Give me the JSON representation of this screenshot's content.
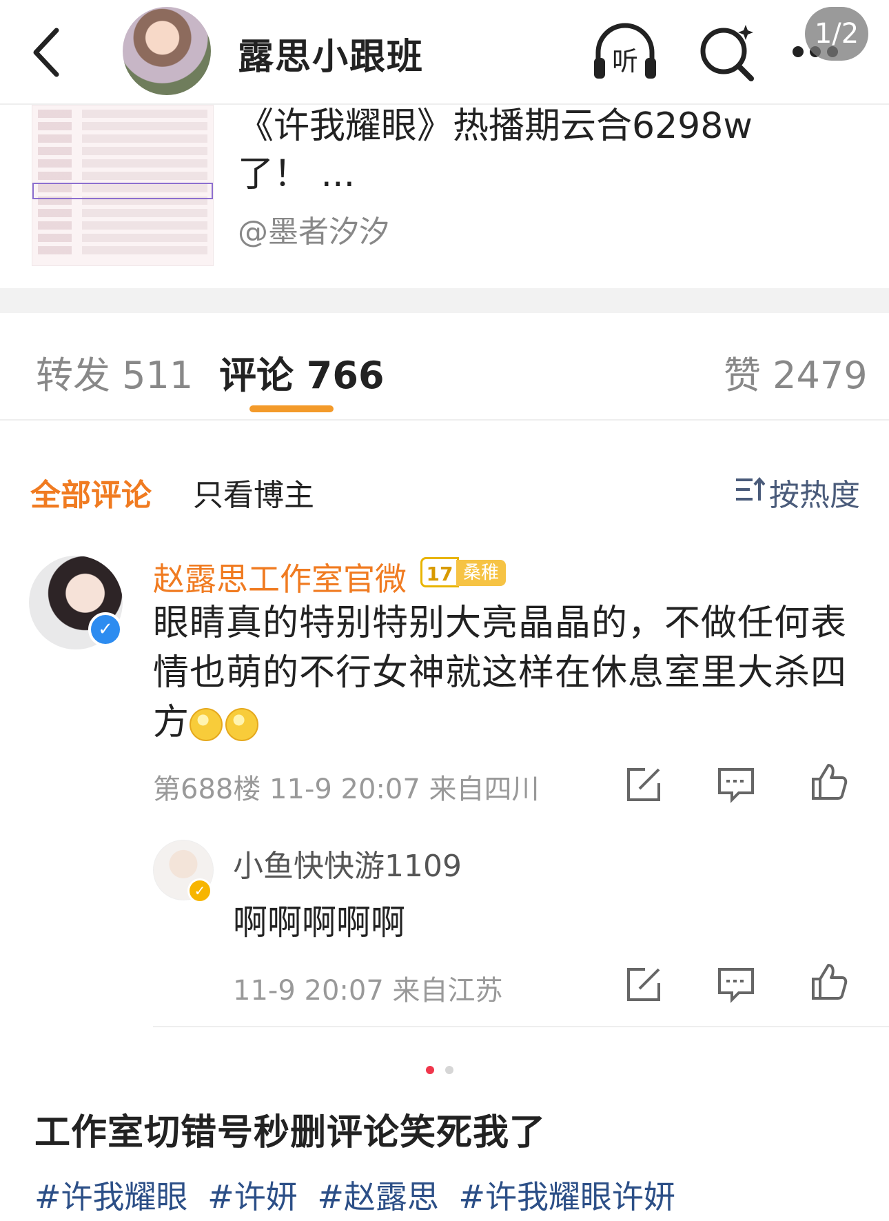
{
  "header": {
    "title": "露思小跟班",
    "page_indicator": "1/2",
    "listen_label": "听"
  },
  "repost_card": {
    "text": "《许我耀眼》热播期云合6298w了！ ...",
    "author": "@墨者汐汐"
  },
  "tabs": {
    "repost": "转发 511",
    "comment": "评论 766",
    "like": "赞 2479"
  },
  "filter": {
    "all": "全部评论",
    "owner_only": "只看博主",
    "sort": "按热度"
  },
  "comment": {
    "username": "赵露思工作室官微",
    "level": "17",
    "level_tag": "桑稚",
    "text": "眼睛真的特别特别大亮晶晶的，不做任何表情也萌的不行女神就这样在休息室里大杀四方",
    "meta": "第688楼 11-9 20:07 来自四川",
    "reply": {
      "username": "小鱼快快游1109",
      "text": "啊啊啊啊啊",
      "meta": "11-9 20:07 来自江苏"
    }
  },
  "post": {
    "caption": "工作室切错号秒删评论笑死我了",
    "tags": [
      "#许我耀眼",
      "#许妍",
      "#赵露思",
      "#许我耀眼许妍"
    ]
  },
  "colors": {
    "accent": "#f07b21",
    "tab_underline": "#f39a2a",
    "tag": "#2c4f87",
    "verified": "#2d8cf0",
    "active_dot": "#f0364b"
  },
  "icons": [
    "back-icon",
    "listen-icon",
    "search-icon",
    "more-icon",
    "sort-icon",
    "share-icon",
    "reply-icon",
    "like-icon",
    "verified-icon"
  ]
}
